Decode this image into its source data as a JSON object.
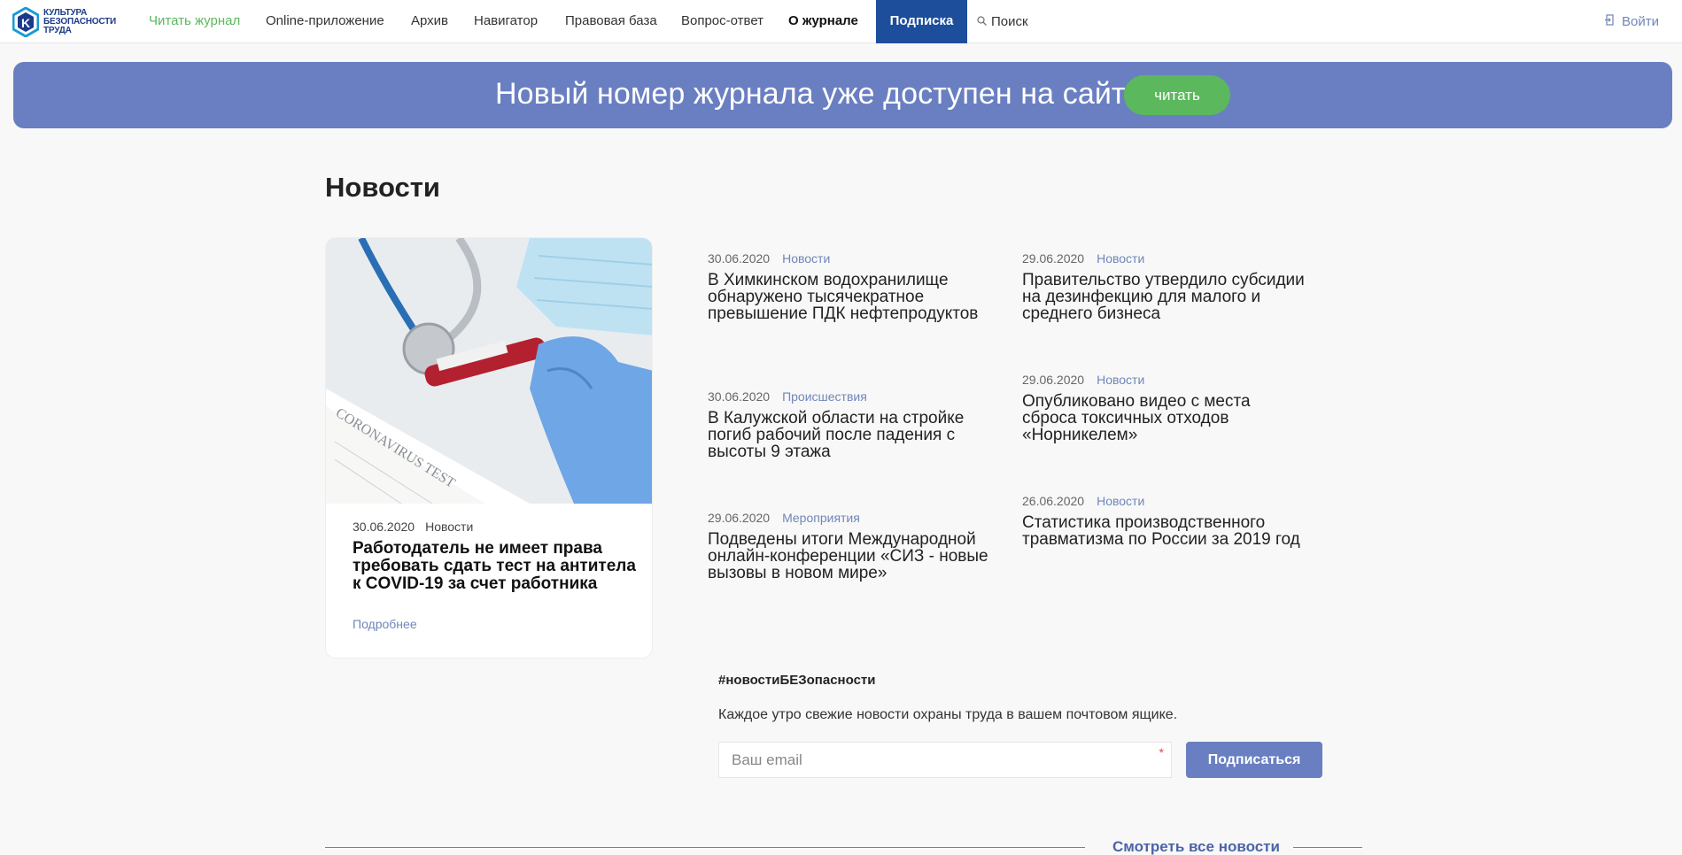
{
  "header": {
    "logo": {
      "line1": "КУЛЬТУРА",
      "line2": "БЕЗОПАСНОСТИ",
      "line3": "ТРУДА"
    },
    "nav": [
      {
        "label": "Читать журнал"
      },
      {
        "label": "Online-приложение"
      },
      {
        "label": "Архив"
      },
      {
        "label": "Навигатор"
      },
      {
        "label": "Правовая база"
      },
      {
        "label": "Вопрос-ответ"
      },
      {
        "label": "О журнале"
      },
      {
        "label": "Подписка"
      }
    ],
    "search_label": "Поиск",
    "login_label": "Войти"
  },
  "banner": {
    "text": "Новый номер журнала уже доступен на сайте!",
    "button": "читать"
  },
  "news_section": {
    "title": "Новости",
    "featured": {
      "date": "30.06.2020",
      "category": "Новости",
      "title": "Работодатель не имеет права требовать сдать тест на антитела к COVID-19 за счет работника",
      "more": "Подробнее",
      "image_caption": "CORONAVIRUS TEST"
    },
    "items": [
      {
        "date": "30.06.2020",
        "category": "Новости",
        "title": "В Химкинском водохранилище обнаружено тысячекратное превышение ПДК нефтепродуктов"
      },
      {
        "date": "29.06.2020",
        "category": "Новости",
        "title": "Правительство утвердило субсидии на дезинфекцию для малого и среднего бизнеса"
      },
      {
        "date": "30.06.2020",
        "category": "Происшествия",
        "title": "В Калужской области на стройке погиб рабочий после падения с высоты 9 этажа"
      },
      {
        "date": "29.06.2020",
        "category": "Новости",
        "title": "Опубликовано видео с места сброса токсичных отходов «Норникелем»"
      },
      {
        "date": "29.06.2020",
        "category": "Мероприятия",
        "title": "Подведены итоги Международной онлайн-конференции «СИЗ - новые вызовы в новом мире»"
      },
      {
        "date": "26.06.2020",
        "category": "Новости",
        "title": "Статистика производственного травматизма по России за 2019 год"
      }
    ]
  },
  "newsletter": {
    "tag": "#новостиБЕЗопасности",
    "description": "Каждое утро свежие новости охраны труда в вашем почтовом ящике.",
    "placeholder": "Ваш email",
    "required_mark": "*",
    "button": "Подписаться"
  },
  "footer_link": "Смотреть все новости",
  "colors": {
    "brand_blue": "#1c4e9c",
    "banner": "#6a7fc1",
    "green": "#5cb85c",
    "link": "#6f86b9"
  }
}
